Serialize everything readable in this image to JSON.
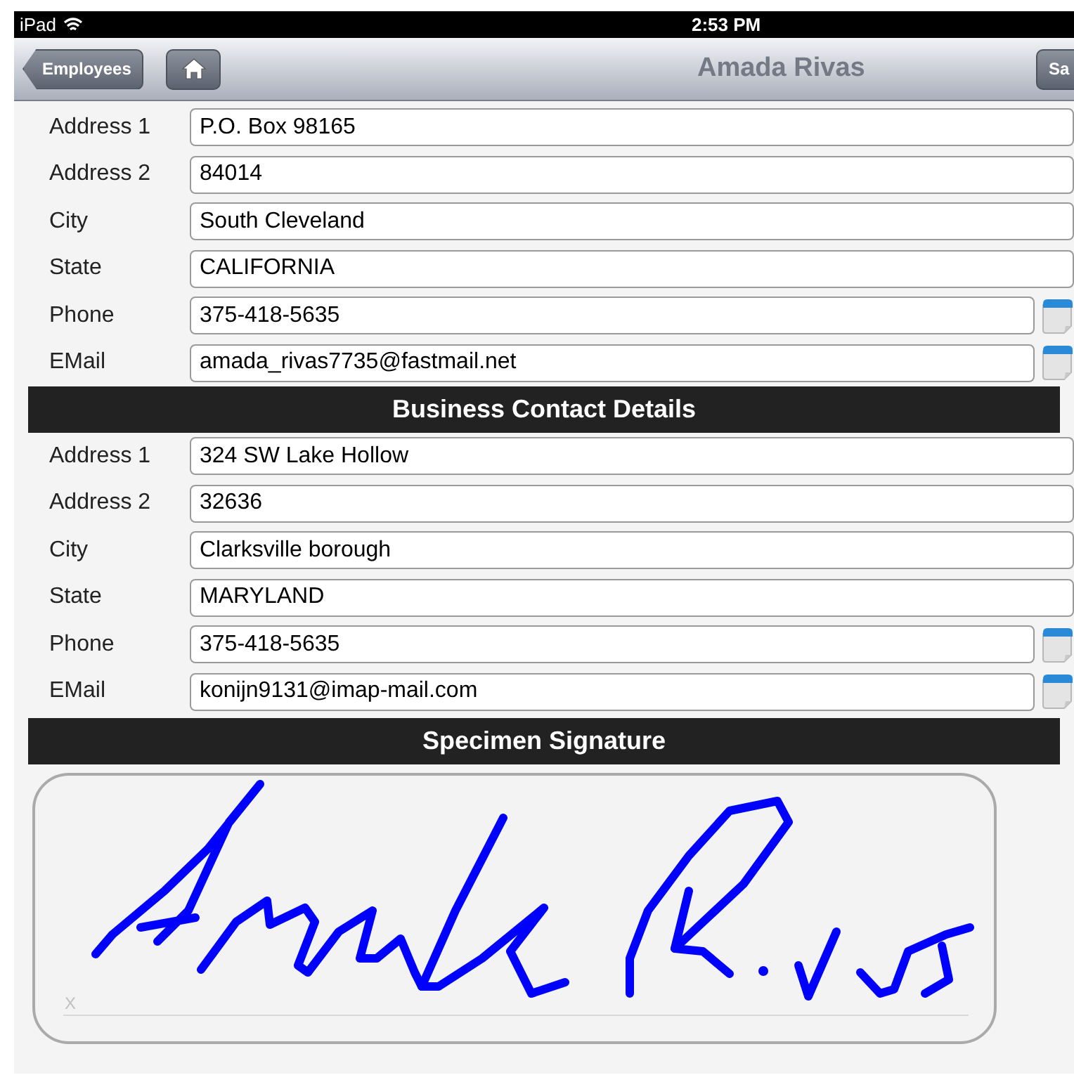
{
  "status_bar": {
    "device": "iPad",
    "time": "2:53 PM"
  },
  "nav_bar": {
    "back_button": "Employees",
    "title": "Amada Rivas",
    "save_button": "Sa"
  },
  "sections": [
    {
      "rows": [
        {
          "label": "Address 1",
          "value": "P.O. Box 98165",
          "has_note": false
        },
        {
          "label": "Address 2",
          "value": "84014",
          "has_note": false
        },
        {
          "label": "City",
          "value": "South Cleveland",
          "has_note": false
        },
        {
          "label": "State",
          "value": "CALIFORNIA",
          "has_note": false
        },
        {
          "label": "Phone",
          "value": "375-418-5635",
          "has_note": true
        },
        {
          "label": "EMail",
          "value": "amada_rivas7735@fastmail.net",
          "has_note": true
        }
      ]
    },
    {
      "title": "Business Contact Details",
      "rows": [
        {
          "label": "Address 1",
          "value": "324 SW Lake Hollow",
          "has_note": false
        },
        {
          "label": "Address 2",
          "value": "32636",
          "has_note": false
        },
        {
          "label": "City",
          "value": "Clarksville borough",
          "has_note": false
        },
        {
          "label": "State",
          "value": "MARYLAND",
          "has_note": false
        },
        {
          "label": "Phone",
          "value": "375-418-5635",
          "has_note": true
        },
        {
          "label": "EMail",
          "value": "konijn9131@imap-mail.com",
          "has_note": true
        }
      ]
    }
  ],
  "signature": {
    "title": "Specimen Signature",
    "line_mark": "X"
  }
}
